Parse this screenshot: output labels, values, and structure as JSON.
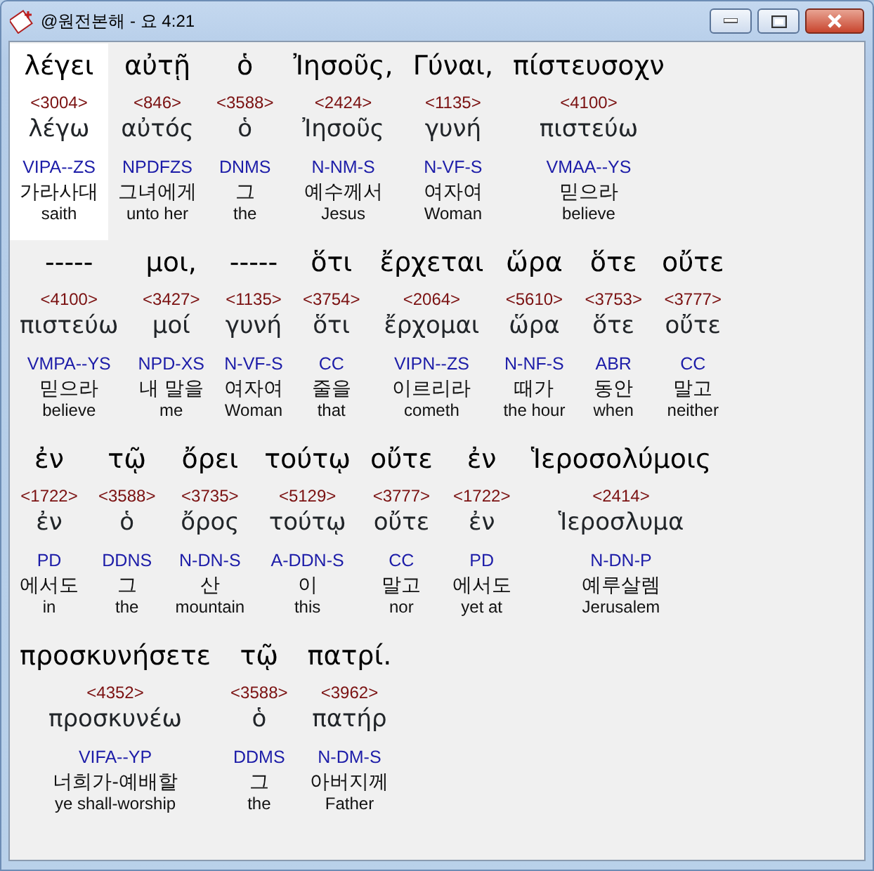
{
  "window": {
    "title": "@원전본해 - 요 4:21"
  },
  "lines": [
    {
      "words": [
        {
          "surface": "λέγει",
          "strong": "<3004>",
          "lemma": "λέγω",
          "morph": "VIPA--ZS",
          "korean": "가라사대",
          "english": "saith",
          "selected": true
        },
        {
          "surface": "αὐτῇ",
          "strong": "<846>",
          "lemma": "αὐτός",
          "morph": "NPDFZS",
          "korean": "그녀에게",
          "english": "unto her",
          "selected": false
        },
        {
          "surface": "ὁ",
          "strong": "<3588>",
          "lemma": "ὁ",
          "morph": "DNMS",
          "korean": "그",
          "english": "the",
          "selected": false
        },
        {
          "surface": "Ἰησοῦς,",
          "strong": "<2424>",
          "lemma": "Ἰησοῦς",
          "morph": "N-NM-S",
          "korean": "예수께서",
          "english": "Jesus",
          "selected": false
        },
        {
          "surface": "Γύναι,",
          "strong": "<1135>",
          "lemma": "γυνή",
          "morph": "N-VF-S",
          "korean": "여자여",
          "english": "Woman",
          "selected": false
        },
        {
          "surface": "πίστευσοχν",
          "strong": "<4100>",
          "lemma": "πιστεύω",
          "morph": "VMAA--YS",
          "korean": "믿으라",
          "english": "believe",
          "selected": false
        }
      ]
    },
    {
      "words": [
        {
          "surface": "-----",
          "strong": "<4100>",
          "lemma": "πιστεύω",
          "morph": "VMPA--YS",
          "korean": "믿으라",
          "english": "believe",
          "selected": false
        },
        {
          "surface": "μοι,",
          "strong": "<3427>",
          "lemma": "μοί",
          "morph": "NPD-XS",
          "korean": "내 말을",
          "english": "me",
          "selected": false
        },
        {
          "surface": "-----",
          "strong": "<1135>",
          "lemma": "γυνή",
          "morph": "N-VF-S",
          "korean": "여자여",
          "english": "Woman",
          "selected": false
        },
        {
          "surface": "ὅτι",
          "strong": "<3754>",
          "lemma": "ὅτι",
          "morph": "CC",
          "korean": "줄을",
          "english": "that",
          "selected": false
        },
        {
          "surface": "ἔρχεται",
          "strong": "<2064>",
          "lemma": "ἔρχομαι",
          "morph": "VIPN--ZS",
          "korean": "이르리라",
          "english": "cometh",
          "selected": false
        },
        {
          "surface": "ὥρα",
          "strong": "<5610>",
          "lemma": "ὥρα",
          "morph": "N-NF-S",
          "korean": "때가",
          "english": "the hour",
          "selected": false
        },
        {
          "surface": "ὅτε",
          "strong": "<3753>",
          "lemma": "ὅτε",
          "morph": "ABR",
          "korean": "동안",
          "english": "when",
          "selected": false
        },
        {
          "surface": "οὔτε",
          "strong": "<3777>",
          "lemma": "οὔτε",
          "morph": "CC",
          "korean": "말고",
          "english": "neither",
          "selected": false
        }
      ]
    },
    {
      "words": [
        {
          "surface": "ἐν",
          "strong": "<1722>",
          "lemma": "ἐν",
          "morph": "PD",
          "korean": "에서도",
          "english": "in",
          "selected": false
        },
        {
          "surface": "τῷ",
          "strong": "<3588>",
          "lemma": "ὁ",
          "morph": "DDNS",
          "korean": "그",
          "english": "the",
          "selected": false
        },
        {
          "surface": "ὄρει",
          "strong": "<3735>",
          "lemma": "ὄρος",
          "morph": "N-DN-S",
          "korean": "산",
          "english": "mountain",
          "selected": false
        },
        {
          "surface": "τούτῳ",
          "strong": "<5129>",
          "lemma": "τούτῳ",
          "morph": "A-DDN-S",
          "korean": "이",
          "english": "this",
          "selected": false
        },
        {
          "surface": "οὔτε",
          "strong": "<3777>",
          "lemma": "οὔτε",
          "morph": "CC",
          "korean": "말고",
          "english": "nor",
          "selected": false
        },
        {
          "surface": "ἐν",
          "strong": "<1722>",
          "lemma": "ἐν",
          "morph": "PD",
          "korean": "에서도",
          "english": "yet at",
          "selected": false
        },
        {
          "surface": "Ἱεροσολύμοις",
          "strong": "<2414>",
          "lemma": "Ἱεροσλυμα",
          "morph": "N-DN-P",
          "korean": "예루살렘",
          "english": "Jerusalem",
          "selected": false
        }
      ]
    },
    {
      "words": [
        {
          "surface": "προσκυνήσετε",
          "strong": "<4352>",
          "lemma": "προσκυνέω",
          "morph": "VIFA--YP",
          "korean": "너희가-예배할",
          "english": "ye shall-worship",
          "selected": false
        },
        {
          "surface": "τῷ",
          "strong": "<3588>",
          "lemma": "ὁ",
          "morph": "DDMS",
          "korean": "그",
          "english": "the",
          "selected": false
        },
        {
          "surface": "πατρί.",
          "strong": "<3962>",
          "lemma": "πατήρ",
          "morph": "N-DM-S",
          "korean": "아버지께",
          "english": "Father",
          "selected": false
        }
      ]
    }
  ]
}
